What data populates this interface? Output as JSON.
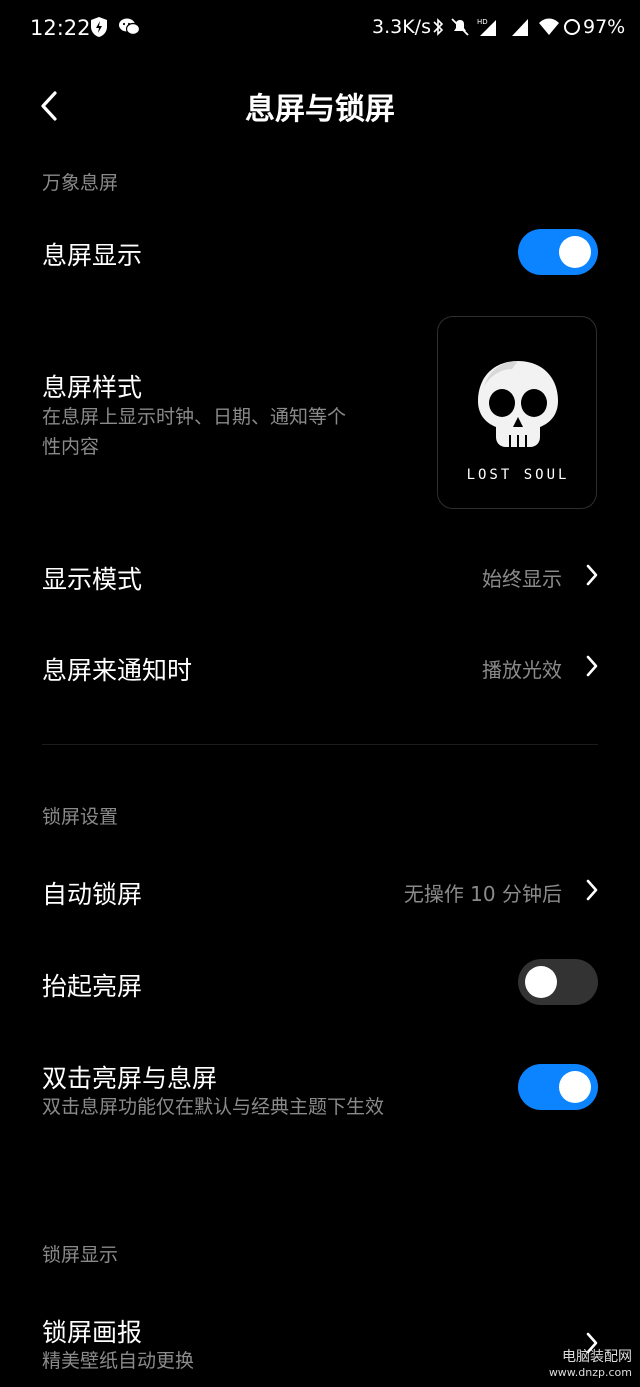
{
  "status_bar": {
    "time": "12:22",
    "net_speed": "3.3K/s",
    "battery": "97%"
  },
  "header": {
    "title": "息屏与锁屏"
  },
  "sections": {
    "aod_label": "万象息屏",
    "lock_label": "锁屏设置",
    "lock_display_label": "锁屏显示"
  },
  "rows": {
    "aod_display": {
      "title": "息屏显示",
      "toggle": true
    },
    "aod_style": {
      "title": "息屏样式",
      "subtitle_line1": "在息屏上显示时钟、日期、通知等个",
      "subtitle_line2": "性内容",
      "preview_text": "LOST SOUL"
    },
    "display_mode": {
      "title": "显示模式",
      "value": "始终显示"
    },
    "aod_notification": {
      "title": "息屏来通知时",
      "value": "播放光效"
    },
    "auto_lock": {
      "title": "自动锁屏",
      "value": "无操作 10 分钟后"
    },
    "raise_to_wake": {
      "title": "抬起亮屏",
      "toggle": false
    },
    "double_tap": {
      "title": "双击亮屏与息屏",
      "subtitle": "双击息屏功能仅在默认与经典主题下生效",
      "toggle": true
    },
    "lock_wallpaper": {
      "title": "锁屏画报",
      "subtitle": "精美壁纸自动更换"
    }
  },
  "watermark": {
    "line1": "电脑装配网",
    "line2": "www.dnzp.com"
  },
  "colors": {
    "accent": "#0d84ff",
    "background": "#000000",
    "secondary_text": "#8a8a8a"
  }
}
